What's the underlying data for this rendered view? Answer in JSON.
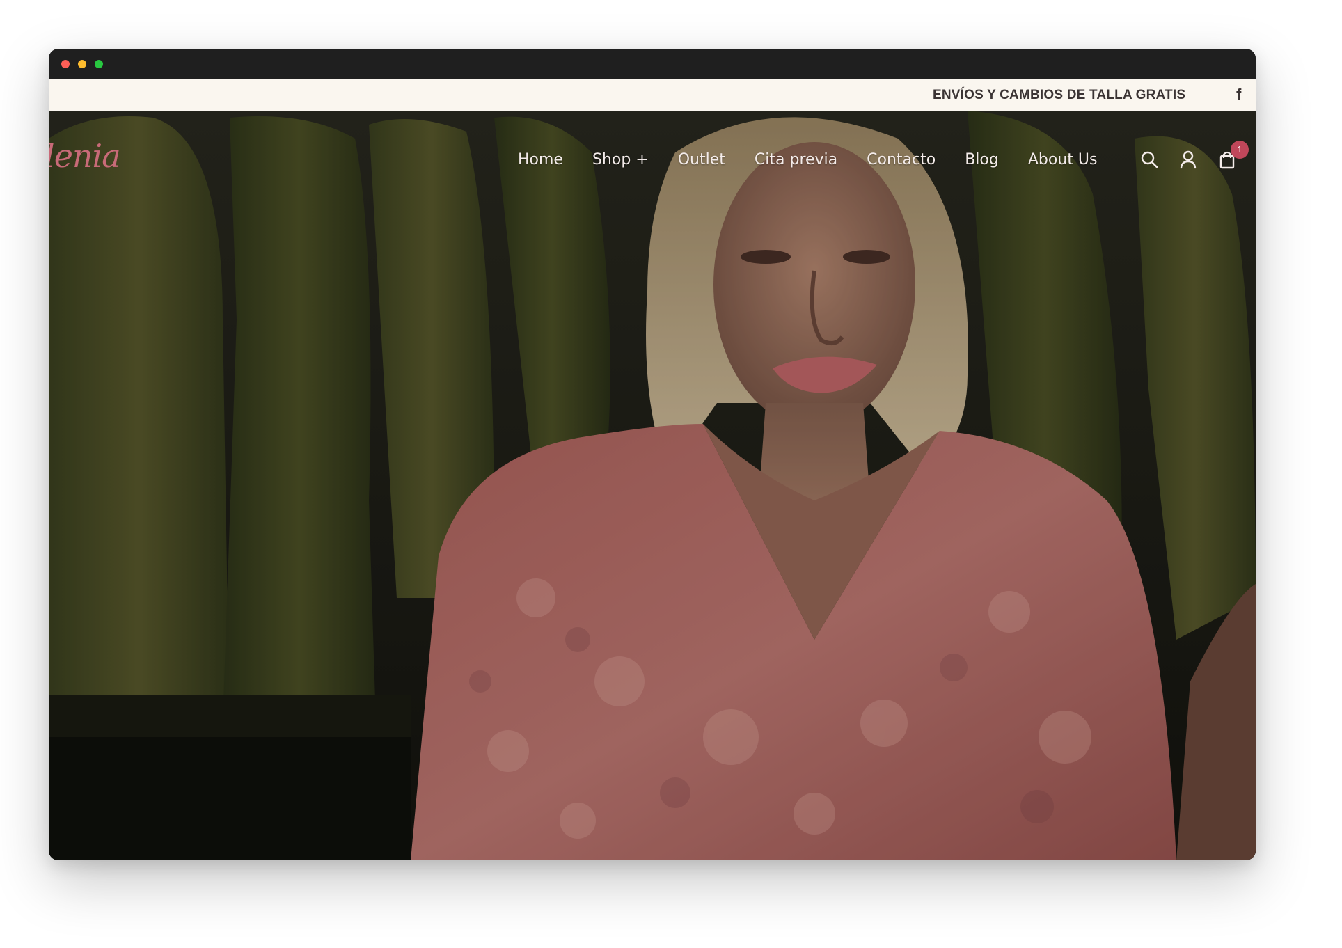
{
  "window": {
    "controls": [
      "close",
      "minimize",
      "zoom"
    ],
    "control_colors": {
      "close": "#fe5f57",
      "minimize": "#febc2e",
      "zoom": "#28c840"
    }
  },
  "announcement": {
    "text": "ENVÍOS Y CAMBIOS DE TALLA GRATIS",
    "social_icon": "facebook-icon",
    "social_glyph": "f"
  },
  "header": {
    "logo_text": "lenia",
    "nav": [
      {
        "label": "Home"
      },
      {
        "label": "Shop +"
      },
      {
        "label": "Outlet"
      },
      {
        "label": "Cita previa"
      },
      {
        "label": "Contacto"
      },
      {
        "label": "Blog"
      },
      {
        "label": "About Us"
      }
    ],
    "icons": [
      "search-icon",
      "user-icon",
      "shopping-bag-icon"
    ],
    "cart_count": "1"
  },
  "colors": {
    "brand": "#c86a78",
    "badge": "#c0475a",
    "announcement_bg": "#faf6ef",
    "announcement_text": "#3b3434",
    "nav_text": "#f4ecea"
  },
  "hero": {
    "media": "video-hero-background"
  }
}
